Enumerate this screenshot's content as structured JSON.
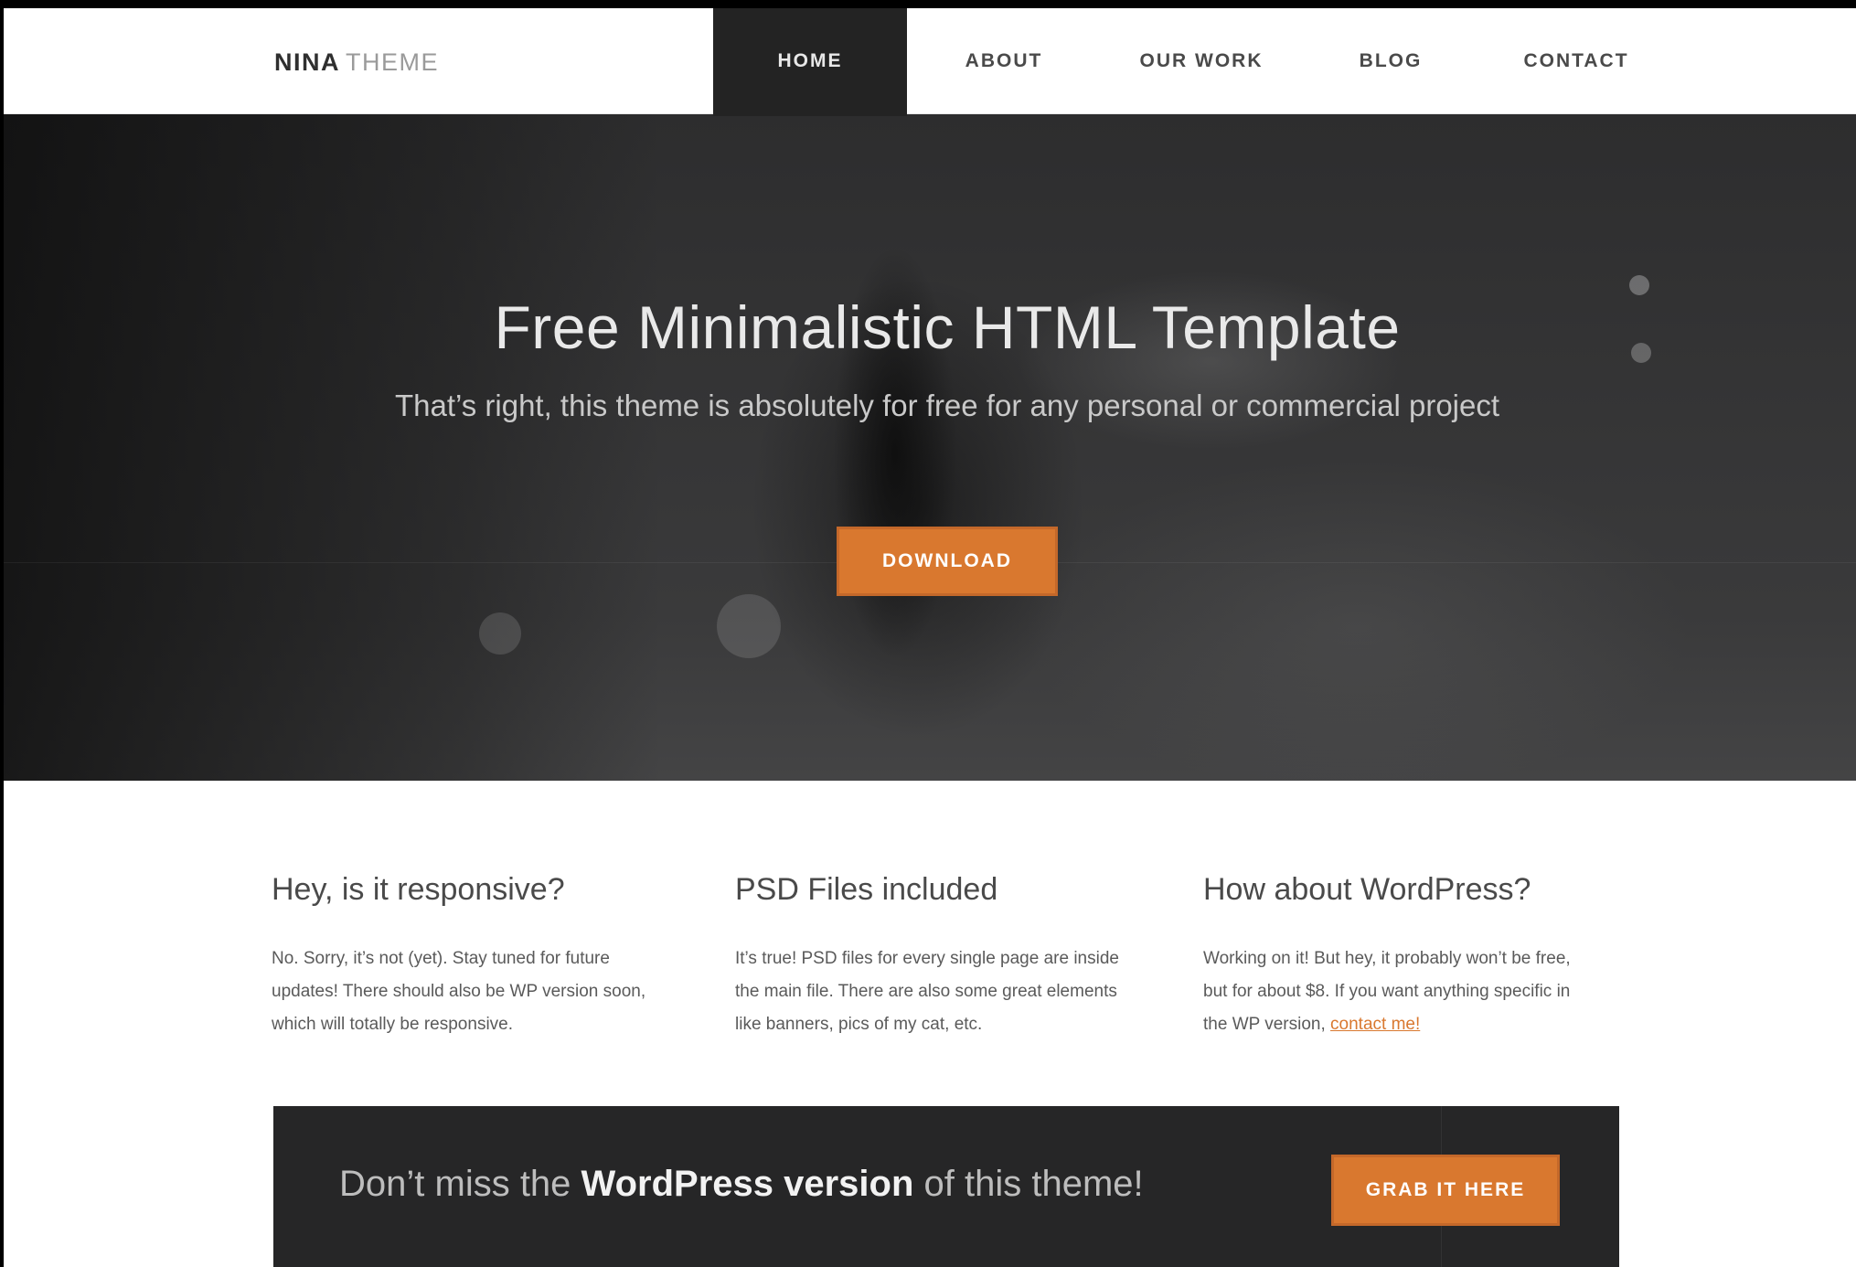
{
  "logo": {
    "strong": "NINA",
    "light": "THEME"
  },
  "nav": {
    "items": [
      {
        "label": "HOME",
        "active": true
      },
      {
        "label": "ABOUT",
        "active": false
      },
      {
        "label": "OUR WORK",
        "active": false
      },
      {
        "label": "BLOG",
        "active": false
      },
      {
        "label": "CONTACT",
        "active": false
      }
    ]
  },
  "hero": {
    "title": "Free Minimalistic HTML Template",
    "subtitle": "That’s right, this theme is absolutely for free for any personal or commercial project",
    "button_label": "DOWNLOAD"
  },
  "features": [
    {
      "title": "Hey, is it responsive?",
      "line1": "No. Sorry, it’s not (yet). Stay tuned for future",
      "line2": "updates! There should also be WP version soon,",
      "line3": "which will totally be responsive."
    },
    {
      "title": "PSD Files included",
      "line1": "It’s true! PSD files for every single page are inside",
      "line2": "the main file. There are also some great elements",
      "line3": "like banners, pics of my cat, etc."
    },
    {
      "title": "How about WordPress?",
      "line1": "Working on it! But hey, it probably won’t be free,",
      "line2": "but for about $8. If you want anything specific in",
      "line3": "the WP version,",
      "link": "contact me!"
    }
  ],
  "banner": {
    "text_before": "Don’t miss the",
    "text_strong": "WordPress version",
    "text_after": "of this theme!",
    "button_label": "GRAB IT HERE"
  },
  "colors": {
    "accent": "#d9782f",
    "nav_active_bg": "#232323",
    "banner_bg": "#262627"
  }
}
